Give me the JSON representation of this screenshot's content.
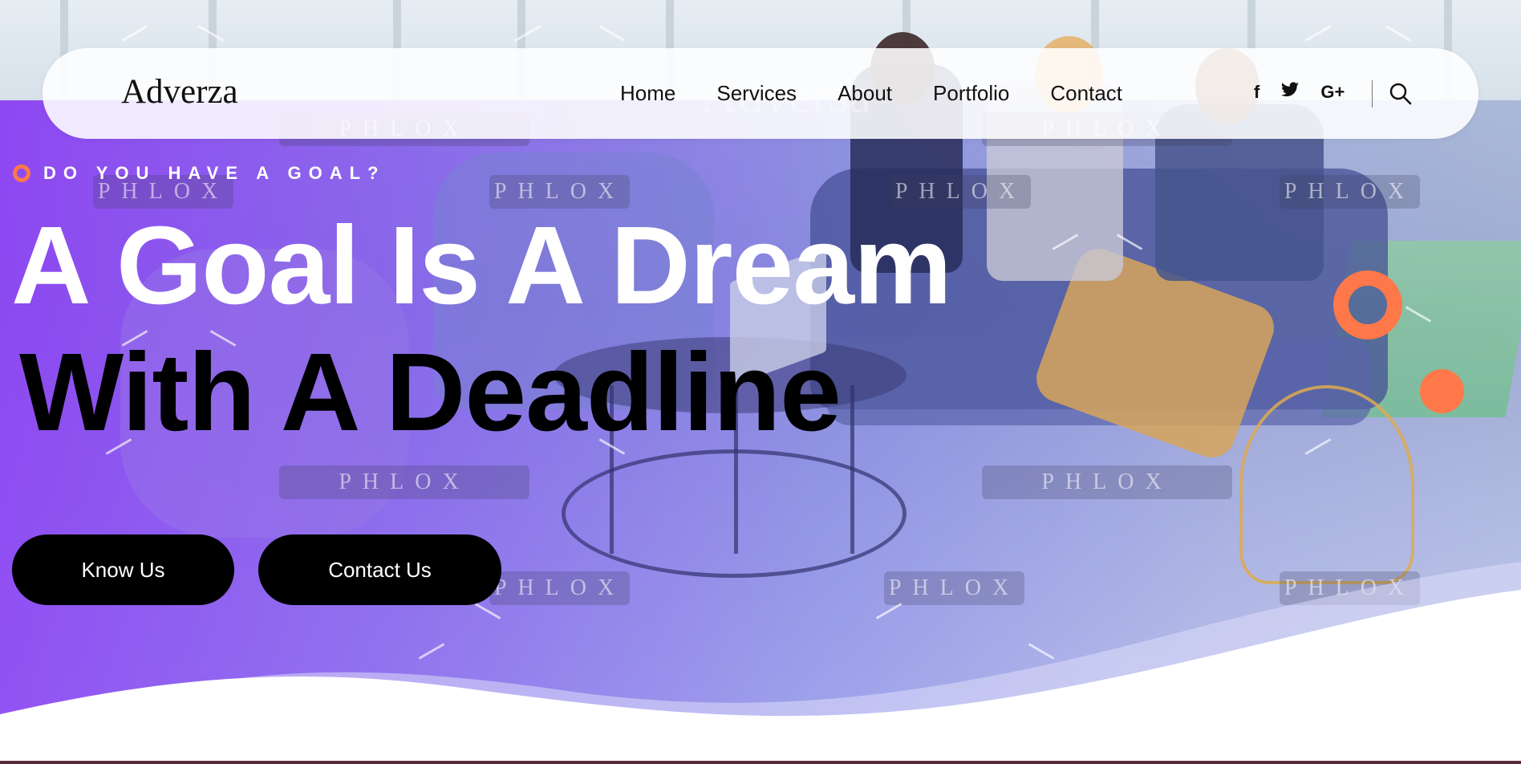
{
  "brand": {
    "logo": "Adverza",
    "ghost_logo": "Adversa"
  },
  "nav": {
    "items": [
      "Home",
      "Services",
      "About",
      "Portfolio",
      "Contact"
    ]
  },
  "social": {
    "icons": [
      "facebook-icon",
      "twitter-icon",
      "google-plus-icon",
      "search-icon"
    ],
    "labels": {
      "facebook": "f",
      "google_plus": "G+"
    }
  },
  "hero": {
    "eyebrow": "DO YOU HAVE A GOAL?",
    "title_line1": "A Goal Is A Dream",
    "title_line2": "With A Deadline",
    "buttons": {
      "primary": "Know Us",
      "secondary": "Contact Us"
    }
  },
  "watermark": "PHLOX",
  "colors": {
    "accent": "#ff7849",
    "button_bg": "#000000",
    "button_text": "#ffffff",
    "overlay_start": "#8c3cf5",
    "nav_bg": "#ffffff"
  }
}
